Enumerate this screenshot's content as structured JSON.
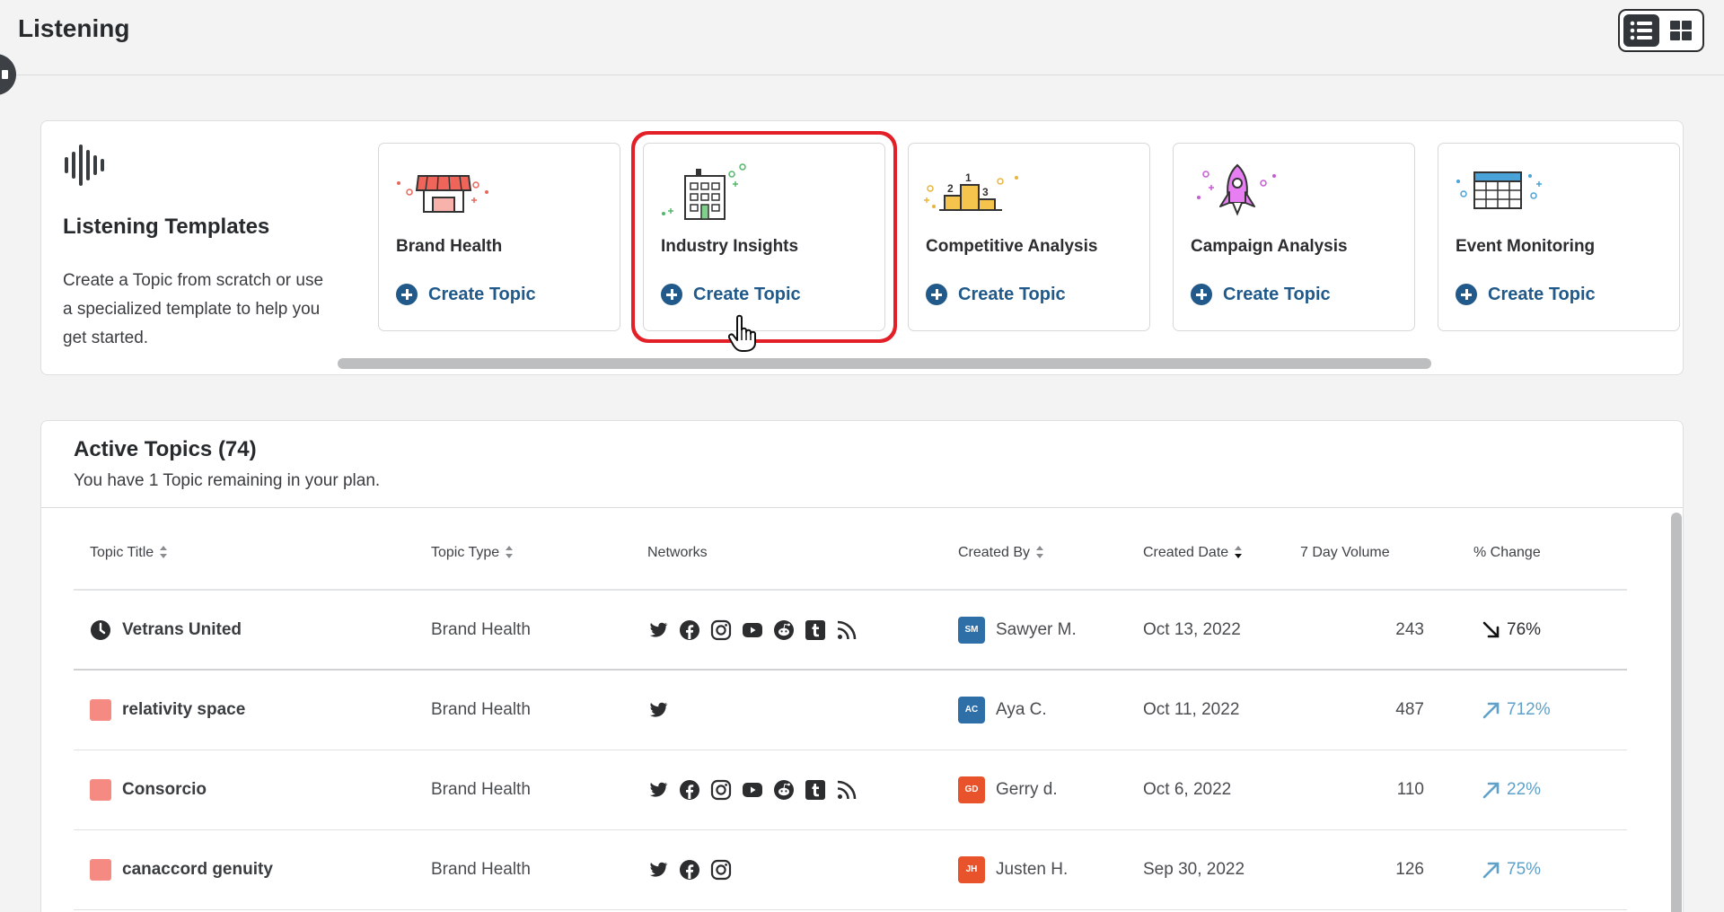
{
  "header": {
    "title": "Listening"
  },
  "view_toggle": {
    "options": [
      "list-view",
      "grid-view"
    ],
    "active": "list-view"
  },
  "templates": {
    "title": "Listening Templates",
    "description": "Create a Topic from scratch or use a specialized template to help you get started.",
    "cards": [
      {
        "title": "Brand Health",
        "action": "Create Topic",
        "icon": "storefront-icon"
      },
      {
        "title": "Industry Insights",
        "action": "Create Topic",
        "icon": "building-icon"
      },
      {
        "title": "Competitive Analysis",
        "action": "Create Topic",
        "icon": "podium-icon"
      },
      {
        "title": "Campaign Analysis",
        "action": "Create Topic",
        "icon": "rocket-icon"
      },
      {
        "title": "Event Monitoring",
        "action": "Create Topic",
        "icon": "calendar-icon"
      }
    ]
  },
  "topics": {
    "title": "Active Topics",
    "count": "(74)",
    "subtitle": "You have 1 Topic remaining in your plan.",
    "columns": [
      "Topic Title",
      "Topic Type",
      "Networks",
      "Created By",
      "Created Date",
      "7 Day Volume",
      "% Change"
    ],
    "rows": [
      {
        "title": "Vetrans United",
        "status": "clock",
        "type": "Brand Health",
        "networks": [
          "twitter",
          "facebook",
          "instagram",
          "youtube",
          "reddit",
          "tumblr",
          "rss"
        ],
        "initials": "SM",
        "avatar_color": "#2f6fa8",
        "creator": "Sawyer M.",
        "date": "Oct 13, 2022",
        "volume": "243",
        "change": "76%",
        "direction": "down"
      },
      {
        "title": "relativity space",
        "status": "square",
        "type": "Brand Health",
        "networks": [
          "twitter"
        ],
        "initials": "AC",
        "avatar_color": "#2f6fa8",
        "creator": "Aya C.",
        "date": "Oct 11, 2022",
        "volume": "487",
        "change": "712%",
        "direction": "up"
      },
      {
        "title": "Consorcio",
        "status": "square",
        "type": "Brand Health",
        "networks": [
          "twitter",
          "facebook",
          "instagram",
          "youtube",
          "reddit",
          "tumblr",
          "rss"
        ],
        "initials": "GD",
        "avatar_color": "#e8532b",
        "creator": "Gerry d.",
        "date": "Oct 6, 2022",
        "volume": "110",
        "change": "22%",
        "direction": "up"
      },
      {
        "title": "canaccord genuity",
        "status": "square",
        "type": "Brand Health",
        "networks": [
          "twitter",
          "facebook",
          "instagram"
        ],
        "initials": "JH",
        "avatar_color": "#e8532b",
        "creator": "Justen H.",
        "date": "Sep 30, 2022",
        "volume": "126",
        "change": "75%",
        "direction": "up"
      }
    ]
  }
}
